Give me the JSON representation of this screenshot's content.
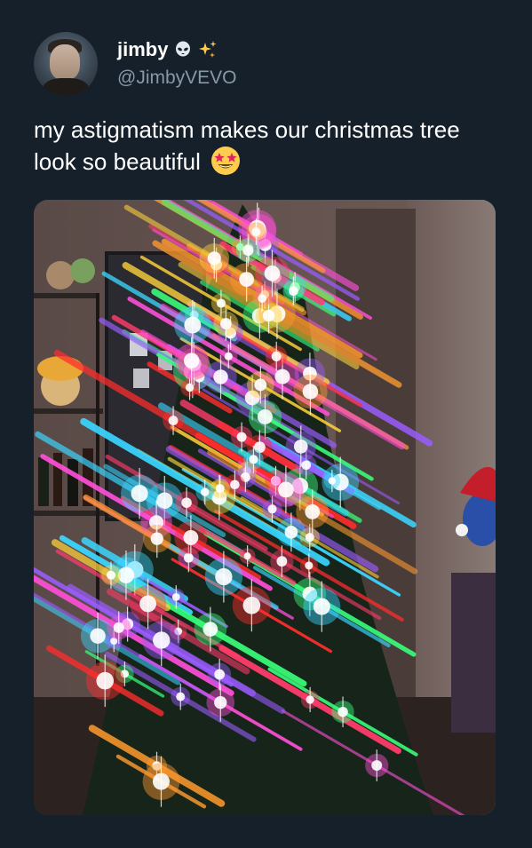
{
  "author": {
    "display_name": "jimby",
    "handle": "@JimbyVEVO",
    "name_emojis": [
      "alien-icon",
      "sparkles-icon"
    ]
  },
  "tweet": {
    "text": "my astigmatism makes our christmas tree look so beautiful",
    "trailing_emoji": "star-struck-emoji-icon"
  },
  "media": {
    "kind": "photo",
    "subject": "christmas-tree-with-starburst-lights"
  },
  "colors": {
    "background": "#15202b",
    "text_primary": "#ffffff",
    "text_secondary": "#8899a6"
  }
}
